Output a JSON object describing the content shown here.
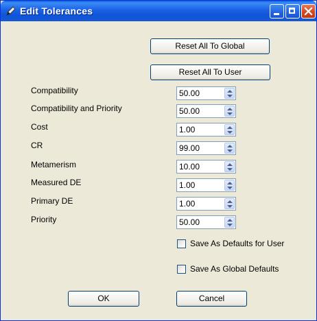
{
  "window": {
    "title": "Edit Tolerances",
    "icon": "edit-pen-icon"
  },
  "buttons": {
    "reset_global": "Reset All To Global",
    "reset_user": "Reset All To User",
    "ok": "OK",
    "cancel": "Cancel"
  },
  "tolerances": [
    {
      "label": "Compatibility",
      "value": "50.00"
    },
    {
      "label": "Compatibility and Priority",
      "value": "50.00"
    },
    {
      "label": "Cost",
      "value": "1.00"
    },
    {
      "label": "CR",
      "value": "99.00"
    },
    {
      "label": "Metamerism",
      "value": "10.00"
    },
    {
      "label": "Measured DE",
      "value": "1.00"
    },
    {
      "label": "Primary DE",
      "value": "1.00"
    },
    {
      "label": "Priority",
      "value": "50.00"
    }
  ],
  "options": {
    "save_user": {
      "label": "Save As Defaults for User",
      "checked": false
    },
    "save_global": {
      "label": "Save As Global Defaults",
      "checked": false
    }
  },
  "colors": {
    "titlebar": "#1b62e6",
    "dialog_bg": "#ece9d8",
    "close_button": "#d1451c"
  }
}
